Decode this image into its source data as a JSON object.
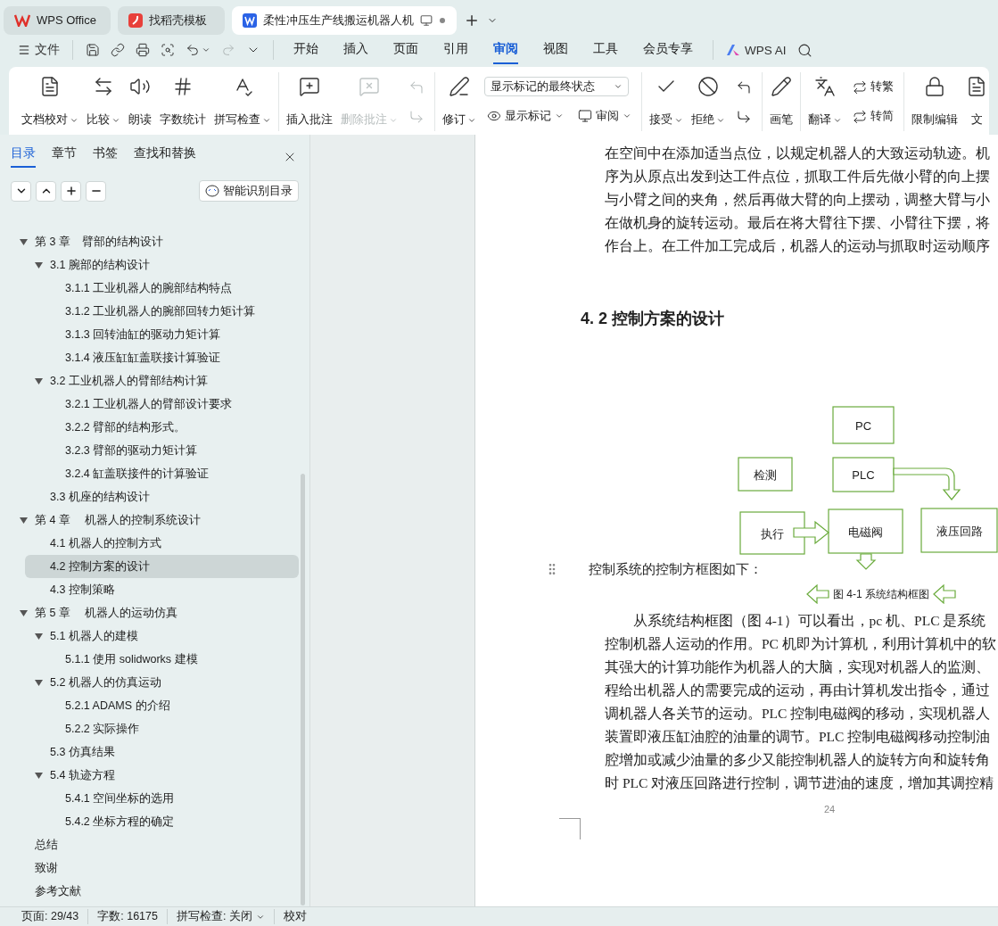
{
  "title_bar": {
    "tabs": [
      {
        "kind": "home",
        "label": "WPS Office",
        "selected": false
      },
      {
        "kind": "template",
        "label": "找稻壳模板",
        "selected": false
      },
      {
        "kind": "document",
        "label": "柔性冲压生产线搬运机器人机",
        "selected": true
      }
    ]
  },
  "menu_bar": {
    "file": "文件",
    "tabs": [
      {
        "label": "开始",
        "selected": false
      },
      {
        "label": "插入",
        "selected": false
      },
      {
        "label": "页面",
        "selected": false
      },
      {
        "label": "引用",
        "selected": false
      },
      {
        "label": "审阅",
        "selected": true
      },
      {
        "label": "视图",
        "selected": false
      },
      {
        "label": "工具",
        "selected": false
      },
      {
        "label": "会员专享",
        "selected": false
      }
    ],
    "ai": "WPS AI"
  },
  "ribbon": {
    "groups": [
      {
        "items": [
          {
            "kind": "large",
            "label": "文档校对",
            "caret": true,
            "disabled": false
          },
          {
            "kind": "large",
            "label": "比较",
            "caret": true,
            "disabled": false
          },
          {
            "kind": "large",
            "label": "朗读",
            "caret": false,
            "disabled": false
          },
          {
            "kind": "large",
            "label": "字数统计",
            "caret": false,
            "disabled": false
          },
          {
            "kind": "large",
            "label": "拼写检查",
            "caret": true,
            "disabled": false
          }
        ]
      },
      {
        "items": [
          {
            "kind": "large",
            "label": "插入批注",
            "caret": false,
            "disabled": false
          },
          {
            "kind": "large",
            "label": "删除批注",
            "caret": true,
            "disabled": true
          },
          {
            "kind": "icon_stack",
            "disabled": true
          }
        ]
      },
      {
        "items": [
          {
            "kind": "large",
            "label": "修订",
            "caret": true,
            "disabled": false
          },
          {
            "kind": "select_stack",
            "select": "显示标记的最终状态",
            "buttons": [
              {
                "label": "显示标记",
                "caret": true
              },
              {
                "label": "审阅",
                "caret": true
              }
            ]
          }
        ]
      },
      {
        "items": [
          {
            "kind": "large",
            "label": "接受",
            "caret": true,
            "disabled": false
          },
          {
            "kind": "large",
            "label": "拒绝",
            "caret": true,
            "disabled": false
          },
          {
            "kind": "icon_stack",
            "disabled": false
          }
        ]
      },
      {
        "items": [
          {
            "kind": "large",
            "label": "画笔",
            "caret": false,
            "disabled": false
          }
        ]
      },
      {
        "items": [
          {
            "kind": "large",
            "label": "翻译",
            "caret": true,
            "disabled": false
          },
          {
            "kind": "text_stack",
            "buttons": [
              {
                "label": "转繁"
              },
              {
                "label": "转简"
              }
            ]
          }
        ]
      },
      {
        "items": [
          {
            "kind": "large",
            "label": "限制编辑",
            "caret": false,
            "disabled": false
          },
          {
            "kind": "large",
            "label": "文",
            "caret": false,
            "disabled": false
          }
        ]
      }
    ]
  },
  "sidebar": {
    "tabs": [
      {
        "label": "目录",
        "selected": true
      },
      {
        "label": "章节",
        "selected": false
      },
      {
        "label": "书签",
        "selected": false
      },
      {
        "label": "查找和替换",
        "selected": false
      }
    ],
    "smart_button": "智能识别目录",
    "toc": [
      {
        "label": "第 3 章　臂部的结构设计",
        "selected": false,
        "expanded": true,
        "children": [
          {
            "label": "3.1  腕部的结构设计",
            "selected": false,
            "expanded": true,
            "children": [
              {
                "label": "3.1.1 工业机器人的腕部结构特点",
                "selected": false
              },
              {
                "label": "3.1.2 工业机器人的腕部回转力矩计算",
                "selected": false
              },
              {
                "label": "3.1.3  回转油缸的驱动力矩计算",
                "selected": false
              },
              {
                "label": "3.1.4  液压缸缸盖联接计算验证",
                "selected": false
              }
            ]
          },
          {
            "label": "3.2  工业机器人的臂部结构计算",
            "selected": false,
            "expanded": true,
            "children": [
              {
                "label": "3.2.1 工业机器人的臂部设计要求",
                "selected": false
              },
              {
                "label": "3.2.2 臂部的结构形式。",
                "selected": false
              },
              {
                "label": "3.2.3 臂部的驱动力矩计算",
                "selected": false
              },
              {
                "label": "3.2.4 缸盖联接件的计算验证",
                "selected": false
              }
            ]
          },
          {
            "label": "3.3  机座的结构设计",
            "selected": false
          }
        ]
      },
      {
        "label": "第 4 章　 机器人的控制系统设计",
        "selected": false,
        "expanded": true,
        "children": [
          {
            "label": "4.1 机器人的控制方式",
            "selected": false
          },
          {
            "label": "4.2 控制方案的设计",
            "selected": true
          },
          {
            "label": "4.3 控制策略",
            "selected": false
          }
        ]
      },
      {
        "label": "第 5 章　  机器人的运动仿真",
        "selected": false,
        "expanded": true,
        "children": [
          {
            "label": "5.1 机器人的建模",
            "selected": false,
            "expanded": true,
            "children": [
              {
                "label": "5.1.1  使用 solidworks 建模",
                "selected": false
              }
            ]
          },
          {
            "label": "5.2  机器人的仿真运动",
            "selected": false,
            "expanded": true,
            "children": [
              {
                "label": "5.2.1 ADAMS 的介绍",
                "selected": false
              },
              {
                "label": "5.2.2 实际操作",
                "selected": false
              }
            ]
          },
          {
            "label": "5.3  仿真结果",
            "selected": false
          },
          {
            "label": "5.4  轨迹方程",
            "selected": false,
            "expanded": true,
            "children": [
              {
                "label": "5.4.1 空间坐标的选用",
                "selected": false
              },
              {
                "label": "5.4.2 坐标方程的确定",
                "selected": false
              }
            ]
          }
        ]
      },
      {
        "label": "总结",
        "selected": false
      },
      {
        "label": "致谢",
        "selected": false
      },
      {
        "label": "参考文献",
        "selected": false
      }
    ]
  },
  "document": {
    "top_lines": [
      "在空间中在添加适当点位，以规定机器人的大致运动轨迹。机",
      "序为从原点出发到达工件点位，抓取工件后先做小臂的向上摆",
      "与小臂之间的夹角，然后再做大臂的向上摆动，调整大臂与小",
      "在做机身的旋转运动。最后在将大臂往下摆、小臂往下摆，将",
      "作台上。在工件加工完成后，机器人的运动与抓取时运动顺序"
    ],
    "heading": "4. 2 控制方案的设计",
    "diagram": {
      "pc": "PC",
      "detect": "检测",
      "plc": "PLC",
      "execute": "执行",
      "valve": "电磁阀",
      "hydraulic": "液压回路"
    },
    "intro": "控制系统的控制方框图如下：",
    "caption": "图 4-1  系统结构框图",
    "paragraph_lines": [
      "从系统结构框图（图 4-1）可以看出，pc 机、PLC 是系统",
      "控制机器人运动的作用。PC 机即为计算机，利用计算机中的软",
      "其强大的计算功能作为机器人的大脑，实现对机器人的监测、",
      "程给出机器人的需要完成的运动，再由计算机发出指令，通过",
      "调机器人各关节的运动。PLC 控制电磁阀的移动，实现机器人",
      "装置即液压缸油腔的油量的调节。PLC 控制电磁阀移动控制油",
      "腔增加或减少油量的多少又能控制机器人的旋转方向和旋转角",
      "时 PLC 对液压回路进行控制，调节进油的速度，增加其调控精"
    ],
    "page_number": "24"
  },
  "status_bar": {
    "items": [
      {
        "kind": "text",
        "label": "页面: 29/43"
      },
      {
        "kind": "text",
        "label": "字数: 16175"
      },
      {
        "kind": "dropdown",
        "label": "拼写检查: 关闭"
      },
      {
        "kind": "text",
        "label": "校对"
      }
    ]
  }
}
